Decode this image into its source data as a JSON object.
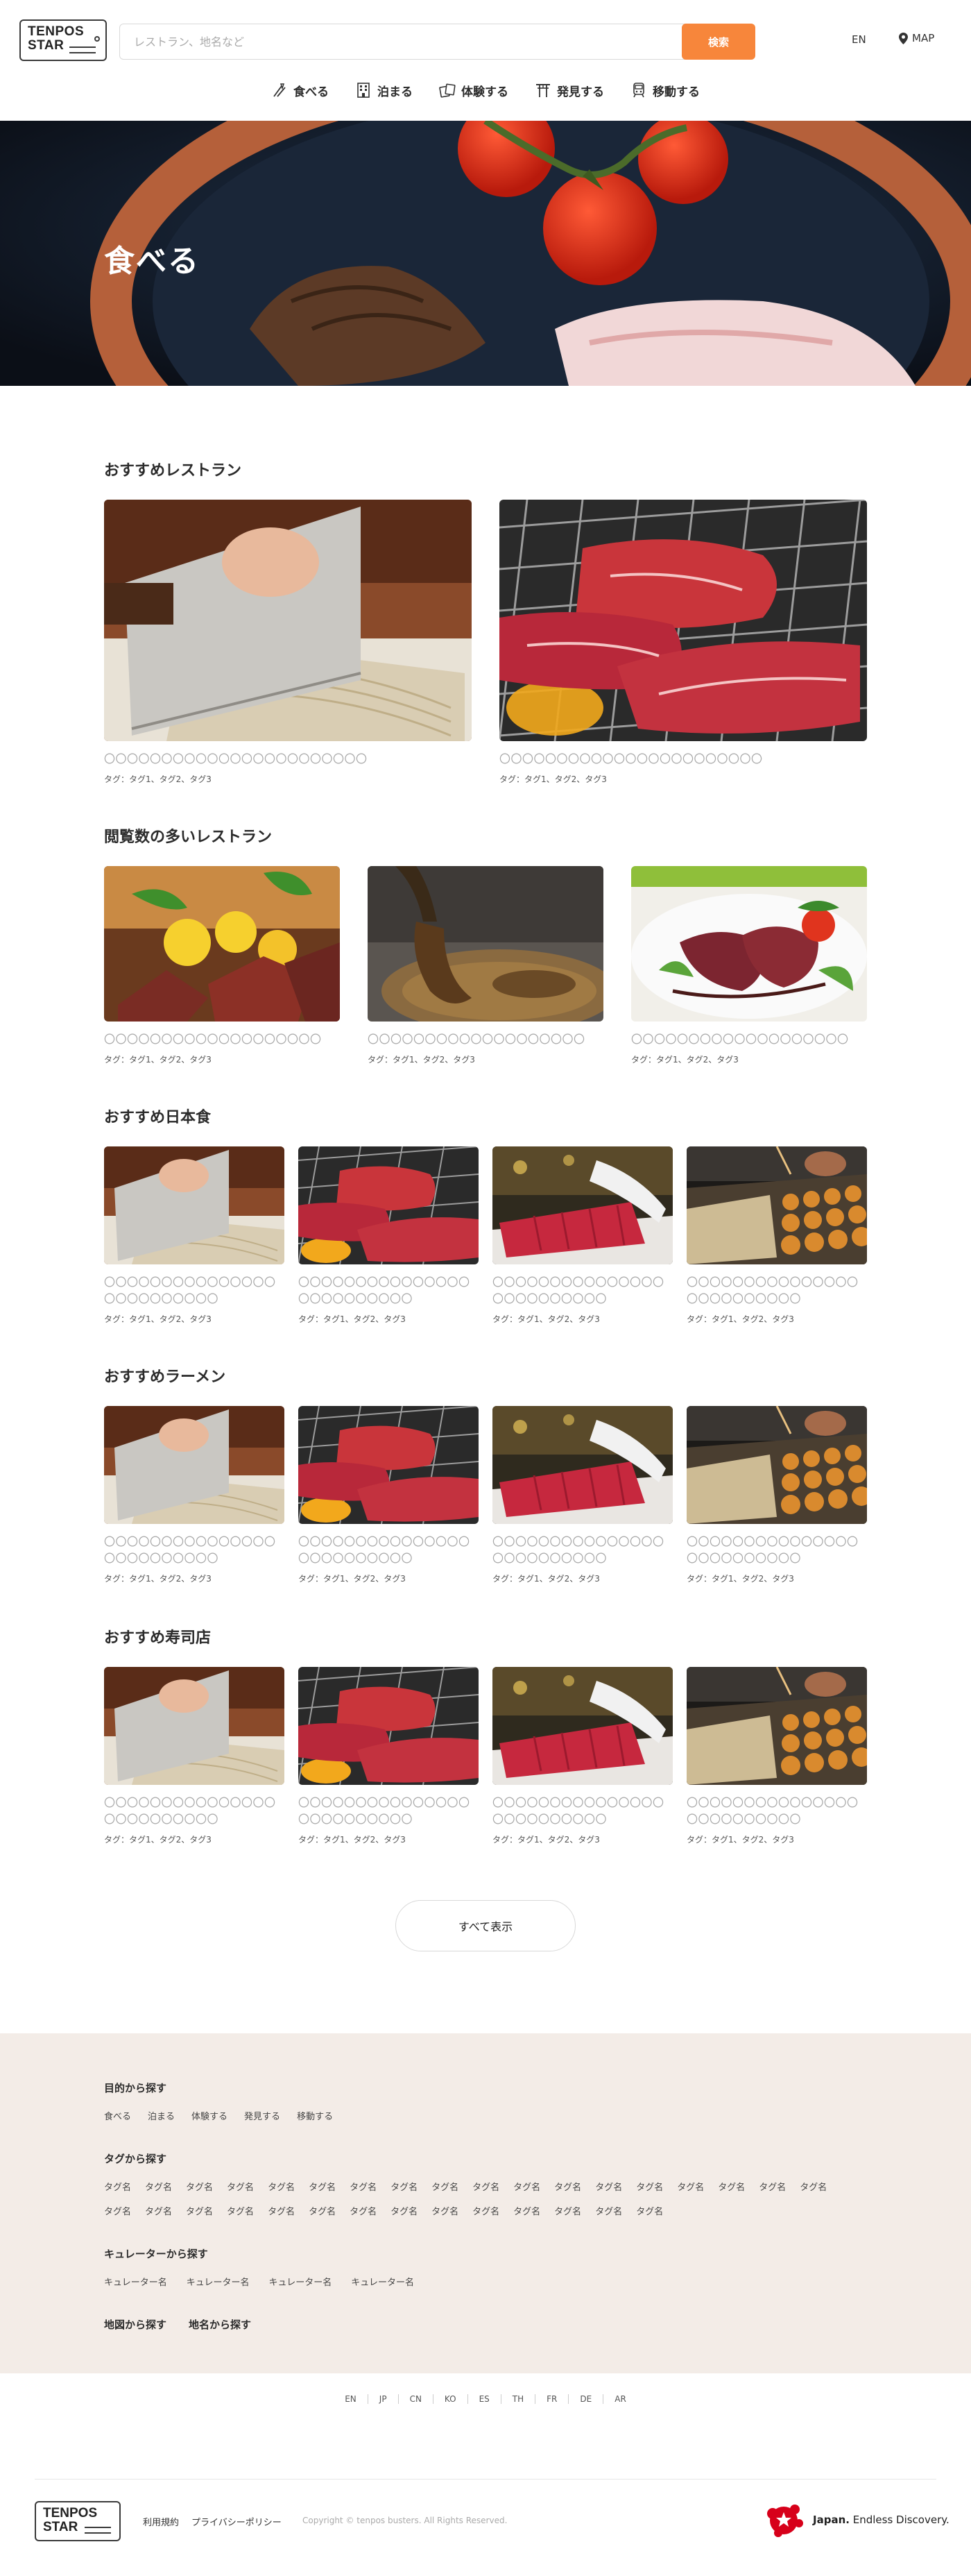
{
  "header": {
    "logo_line1": "TENPOS",
    "logo_line2": "STAR",
    "search_placeholder": "レストラン、地名など",
    "search_button": "検索",
    "lang": "EN",
    "map": "MAP",
    "brand_color": "#f7863b"
  },
  "nav": [
    {
      "label": "食べる",
      "icon": "fork-knife-icon"
    },
    {
      "label": "泊まる",
      "icon": "building-icon"
    },
    {
      "label": "体験する",
      "icon": "cards-icon"
    },
    {
      "label": "発見する",
      "icon": "torii-icon"
    },
    {
      "label": "移動する",
      "icon": "train-icon"
    }
  ],
  "hero": {
    "title": "食べる"
  },
  "sections": {
    "recommended": {
      "title": "おすすめレストラン",
      "cards": [
        {
          "title": "〇〇〇〇〇〇〇〇〇〇〇〇〇〇〇〇〇〇〇〇〇〇〇",
          "tags": "タグ：タグ1、タグ2、タグ3",
          "photo": "soba-cutting"
        },
        {
          "title": "〇〇〇〇〇〇〇〇〇〇〇〇〇〇〇〇〇〇〇〇〇〇〇",
          "tags": "タグ：タグ1、タグ2、タグ3",
          "photo": "wagyu-grill"
        }
      ]
    },
    "popular": {
      "title": "閲覧数の多いレストラン",
      "cards": [
        {
          "title": "〇〇〇〇〇〇〇〇〇〇〇〇〇〇〇〇〇〇〇",
          "tags": "タグ：タグ1、タグ2、タグ3",
          "photo": "steak-lemon"
        },
        {
          "title": "〇〇〇〇〇〇〇〇〇〇〇〇〇〇〇〇〇〇〇",
          "tags": "タグ：タグ1、タグ2、タグ3",
          "photo": "sauce-pour"
        },
        {
          "title": "〇〇〇〇〇〇〇〇〇〇〇〇〇〇〇〇〇〇〇",
          "tags": "タグ：タグ1、タグ2、タグ3",
          "photo": "beef-plate"
        }
      ]
    },
    "japanese": {
      "title": "おすすめ日本食",
      "cards": [
        {
          "title": "〇〇〇〇〇〇〇〇〇〇〇〇〇〇〇〇〇〇〇〇〇〇〇〇〇",
          "tags": "タグ：タグ1、タグ2、タグ3",
          "photo": "soba-cutting"
        },
        {
          "title": "〇〇〇〇〇〇〇〇〇〇〇〇〇〇〇〇〇〇〇〇〇〇〇〇〇",
          "tags": "タグ：タグ1、タグ2、タグ3",
          "photo": "wagyu-grill"
        },
        {
          "title": "〇〇〇〇〇〇〇〇〇〇〇〇〇〇〇〇〇〇〇〇〇〇〇〇〇",
          "tags": "タグ：タグ1、タグ2、タグ3",
          "photo": "tuna-cut"
        },
        {
          "title": "〇〇〇〇〇〇〇〇〇〇〇〇〇〇〇〇〇〇〇〇〇〇〇〇〇",
          "tags": "タグ：タグ1、タグ2、タグ3",
          "photo": "takoyaki"
        }
      ]
    },
    "ramen": {
      "title": "おすすめラーメン",
      "cards": [
        {
          "title": "〇〇〇〇〇〇〇〇〇〇〇〇〇〇〇〇〇〇〇〇〇〇〇〇〇",
          "tags": "タグ：タグ1、タグ2、タグ3",
          "photo": "soba-cutting"
        },
        {
          "title": "〇〇〇〇〇〇〇〇〇〇〇〇〇〇〇〇〇〇〇〇〇〇〇〇〇",
          "tags": "タグ：タグ1、タグ2、タグ3",
          "photo": "wagyu-grill"
        },
        {
          "title": "〇〇〇〇〇〇〇〇〇〇〇〇〇〇〇〇〇〇〇〇〇〇〇〇〇",
          "tags": "タグ：タグ1、タグ2、タグ3",
          "photo": "tuna-cut"
        },
        {
          "title": "〇〇〇〇〇〇〇〇〇〇〇〇〇〇〇〇〇〇〇〇〇〇〇〇〇",
          "tags": "タグ：タグ1、タグ2、タグ3",
          "photo": "takoyaki"
        }
      ]
    },
    "sushi": {
      "title": "おすすめ寿司店",
      "cards": [
        {
          "title": "〇〇〇〇〇〇〇〇〇〇〇〇〇〇〇〇〇〇〇〇〇〇〇〇〇",
          "tags": "タグ：タグ1、タグ2、タグ3",
          "photo": "soba-cutting"
        },
        {
          "title": "〇〇〇〇〇〇〇〇〇〇〇〇〇〇〇〇〇〇〇〇〇〇〇〇〇",
          "tags": "タグ：タグ1、タグ2、タグ3",
          "photo": "wagyu-grill"
        },
        {
          "title": "〇〇〇〇〇〇〇〇〇〇〇〇〇〇〇〇〇〇〇〇〇〇〇〇〇",
          "tags": "タグ：タグ1、タグ2、タグ3",
          "photo": "tuna-cut"
        },
        {
          "title": "〇〇〇〇〇〇〇〇〇〇〇〇〇〇〇〇〇〇〇〇〇〇〇〇〇",
          "tags": "タグ：タグ1、タグ2、タグ3",
          "photo": "takoyaki"
        }
      ]
    }
  },
  "show_all": "すべて表示",
  "footer": {
    "purpose": {
      "title": "目的から探す",
      "links": [
        "食べる",
        "泊まる",
        "体験する",
        "発見する",
        "移動する"
      ]
    },
    "tags": {
      "title": "タグから探す",
      "links": [
        "タグ名",
        "タグ名",
        "タグ名",
        "タグ名",
        "タグ名",
        "タグ名",
        "タグ名",
        "タグ名",
        "タグ名",
        "タグ名",
        "タグ名",
        "タグ名",
        "タグ名",
        "タグ名",
        "タグ名",
        "タグ名",
        "タグ名",
        "タグ名",
        "タグ名",
        "タグ名",
        "タグ名",
        "タグ名",
        "タグ名",
        "タグ名",
        "タグ名",
        "タグ名",
        "タグ名",
        "タグ名",
        "タグ名",
        "タグ名",
        "タグ名",
        "タグ名"
      ]
    },
    "curator": {
      "title": "キュレーターから探す",
      "links": [
        "キュレーター名",
        "キュレーター名",
        "キュレーター名",
        "キュレーター名"
      ]
    },
    "map_search": "地図から探す",
    "area_search": "地名から探す",
    "bg_color": "#f3ece7"
  },
  "languages": [
    "EN",
    "JP",
    "CN",
    "KO",
    "ES",
    "TH",
    "FR",
    "DE",
    "AR"
  ],
  "bottom": {
    "logo_line1": "TENPOS",
    "logo_line2": "STAR",
    "terms": "利用規約",
    "privacy": "プライバシーポリシー",
    "copyright": "Copyright © tenpos busters. All Rights Reserved.",
    "jnto_bold": "Japan.",
    "jnto_rest": " Endless Discovery."
  }
}
